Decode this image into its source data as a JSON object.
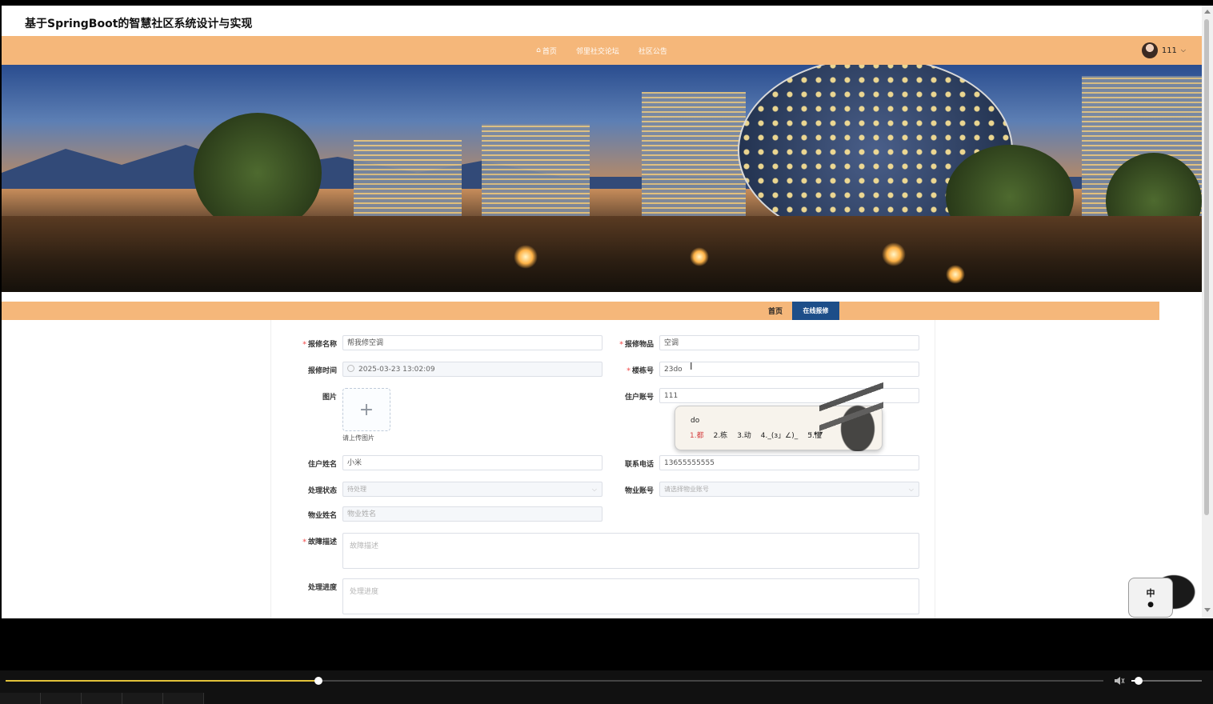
{
  "header": {
    "title": "基于SpringBoot的智慧社区系统设计与实现"
  },
  "nav": {
    "items": [
      {
        "label": "首页",
        "icon": "home-icon"
      },
      {
        "label": "邻里社交论坛"
      },
      {
        "label": "社区公告"
      }
    ],
    "user": {
      "name": "111",
      "caret": "⌵"
    }
  },
  "breadcrumb": {
    "home": "首页",
    "current": "在线报修"
  },
  "form": {
    "name": {
      "label": "报修名称",
      "value": "帮我修空调",
      "required": true
    },
    "item": {
      "label": "报修物品",
      "value": "空调",
      "required": true
    },
    "time": {
      "label": "报修时间",
      "value": "2025-03-23 13:02:09"
    },
    "building": {
      "label": "楼栋号",
      "value": "23do",
      "required": true
    },
    "image": {
      "label": "图片",
      "plus": "+",
      "hint": "请上传图片"
    },
    "account": {
      "label": "住户账号",
      "value": "111"
    },
    "residentName": {
      "label": "住户姓名",
      "value": "小米"
    },
    "phone": {
      "label": "联系电话",
      "value": "13655555555"
    },
    "status": {
      "label": "处理状态",
      "value": "待处理"
    },
    "propAccount": {
      "label": "物业账号",
      "placeholder": "请选择物业账号"
    },
    "propName": {
      "label": "物业姓名",
      "placeholder": "物业姓名"
    },
    "fault": {
      "label": "故障描述",
      "placeholder": "故障描述",
      "required": true
    },
    "progress": {
      "label": "处理进度",
      "placeholder": "处理进度"
    }
  },
  "ime": {
    "composition": "do",
    "candidates": [
      "1.都",
      "2.栋",
      "3.动",
      "4._(ɜ」∠)_",
      "5.懂"
    ],
    "nav": "‹ ▸ ▾",
    "tray": {
      "mode": "中"
    }
  },
  "player": {
    "progress": 0.285,
    "volume": 0.1
  },
  "colors": {
    "accent": "#f5b77a",
    "active": "#1d4e89",
    "required": "#f56c6c"
  }
}
